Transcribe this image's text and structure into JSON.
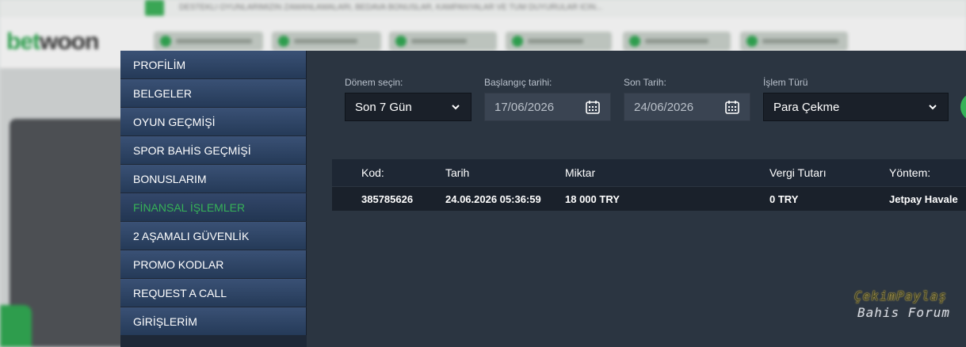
{
  "background": {
    "ticker_text": "DESTEKLI OYUNLARIMIZIN ZAMANLAMALARI, BEDAVA BONUSLAR, KAMPANYALAR VE TUM DUYURULAR ICIN..."
  },
  "sidebar": {
    "items": [
      {
        "label": "PROFİLİM",
        "active": false
      },
      {
        "label": "BELGELER",
        "active": false
      },
      {
        "label": "OYUN GEÇMİŞİ",
        "active": false
      },
      {
        "label": "SPOR BAHİS GEÇMİŞİ",
        "active": false
      },
      {
        "label": "BONUSLARIM",
        "active": false
      },
      {
        "label": "FİNANSAL İŞLEMLER",
        "active": true
      },
      {
        "label": "2 AŞAMALI GÜVENLİK",
        "active": false
      },
      {
        "label": "PROMO KODLAR",
        "active": false
      },
      {
        "label": "REQUEST A CALL",
        "active": false
      },
      {
        "label": "GİRİŞLERİM",
        "active": false
      }
    ]
  },
  "filters": {
    "period": {
      "label": "Dönem seçin:",
      "value": "Son 7 Gün"
    },
    "start_date": {
      "label": "Başlangıç tarihi:",
      "value": "17/06/2026"
    },
    "end_date": {
      "label": "Son Tarih:",
      "value": "24/06/2026"
    },
    "type": {
      "label": "İşlem Türü",
      "value": "Para Çekme"
    }
  },
  "table": {
    "headers": {
      "code": "Kod:",
      "date": "Tarih",
      "amount": "Miktar",
      "tax": "Vergi Tutarı",
      "method": "Yöntem:"
    },
    "rows": [
      {
        "code": "385785626",
        "date": "24.06.2026 05:36:59",
        "amount": "18 000 TRY",
        "tax": "0 TRY",
        "method": "Jetpay Havale"
      }
    ]
  },
  "watermark": {
    "line1": "ÇekimPaylaş",
    "line2": "Bahis Forum"
  },
  "colors": {
    "accent_green": "#36b258",
    "modal_bg": "#2b3541",
    "sidebar_item": "#2e4466"
  }
}
